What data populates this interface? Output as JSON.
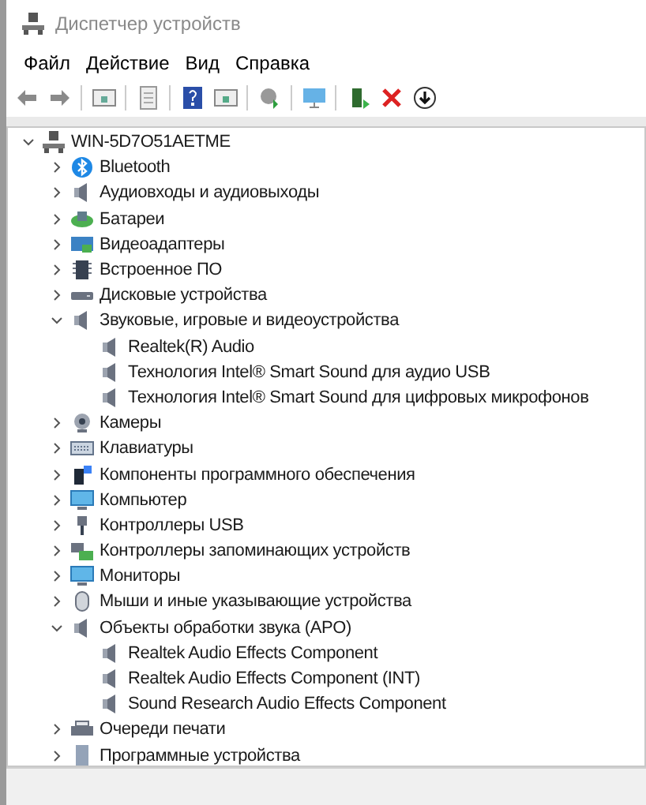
{
  "window": {
    "title": "Диспетчер устройств"
  },
  "menu": [
    "Файл",
    "Действие",
    "Вид",
    "Справка"
  ],
  "tree": {
    "label": "WIN-5D7O51AETME",
    "expanded": true,
    "children": [
      {
        "label": "Bluetooth",
        "expanded": false
      },
      {
        "label": "Аудиовходы и аудиовыходы",
        "expanded": false
      },
      {
        "label": "Батареи",
        "expanded": false
      },
      {
        "label": "Видеоадаптеры",
        "expanded": false
      },
      {
        "label": "Встроенное ПО",
        "expanded": false
      },
      {
        "label": "Дисковые устройства",
        "expanded": false
      },
      {
        "label": "Звуковые, игровые и видеоустройства",
        "expanded": true,
        "children": [
          {
            "label": "Realtek(R) Audio"
          },
          {
            "label": "Технология Intel® Smart Sound для аудио USB"
          },
          {
            "label": "Технология Intel® Smart Sound для цифровых микрофонов"
          }
        ]
      },
      {
        "label": "Камеры",
        "expanded": false
      },
      {
        "label": "Клавиатуры",
        "expanded": false
      },
      {
        "label": "Компоненты программного обеспечения",
        "expanded": false
      },
      {
        "label": "Компьютер",
        "expanded": false
      },
      {
        "label": "Контроллеры USB",
        "expanded": false
      },
      {
        "label": "Контроллеры запоминающих устройств",
        "expanded": false
      },
      {
        "label": "Мониторы",
        "expanded": false
      },
      {
        "label": "Мыши и иные указывающие устройства",
        "expanded": false
      },
      {
        "label": "Объекты обработки звука (APO)",
        "expanded": true,
        "children": [
          {
            "label": "Realtek Audio Effects Component"
          },
          {
            "label": "Realtek Audio Effects Component (INT)"
          },
          {
            "label": "Sound Research Audio Effects Component"
          }
        ]
      },
      {
        "label": "Очереди печати",
        "expanded": false
      },
      {
        "label": "Программные устройства",
        "expanded": false
      }
    ]
  }
}
